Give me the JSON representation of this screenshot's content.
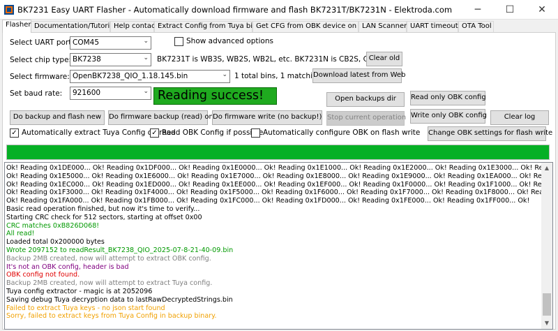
{
  "window": {
    "title": "BK7231 Easy UART Flasher - Automatically download firmware and flash BK7231T/BK7231N - Elektroda.com",
    "minimize_glyph": "─",
    "maximize_glyph": "☐",
    "close_glyph": "✕"
  },
  "tabs": [
    {
      "label": "Flasher"
    },
    {
      "label": "Documentation/Tutorials"
    },
    {
      "label": "Help contact"
    },
    {
      "label": "Extract Config from Tuya binary"
    },
    {
      "label": "Get CFG from OBK device on LAN"
    },
    {
      "label": "LAN Scanner"
    },
    {
      "label": "UART timeouts"
    },
    {
      "label": "OTA Tool"
    }
  ],
  "form": {
    "uart_port_label": "Select UART port:",
    "uart_port_value": "COM45",
    "show_advanced_label": "Show advanced options",
    "chip_type_label": "Select chip type:",
    "chip_type_value": "BK7238",
    "chip_info": "BK7231T is WB3S, WB2S, WB2L, etc. BK7231N is CB2S, CB3S, etc",
    "clear_old_label": "Clear old",
    "firmware_label": "Select firmware:",
    "firmware_value": "OpenBK7238_QIO_1.18.145.bin",
    "firmware_info": "1 total bins, 1 matching.",
    "download_latest_label": "Download latest from Web",
    "baud_label": "Set baud rate:",
    "baud_value": "921600",
    "status_text": "Reading success!"
  },
  "buttons": {
    "open_backups": "Open backups dir",
    "read_only_obk": "Read only OBK config",
    "backup_and_flash": "Do backup and flash new",
    "firmware_backup": "Do firmware backup (read) only",
    "firmware_write": "Do firmware write (no backup!)",
    "stop_operation": "Stop current operation",
    "write_only_obk": "Write only OBK config",
    "clear_log": "Clear log",
    "change_obk_settings": "Change OBK settings for flash write"
  },
  "checkboxes": {
    "extract_tuya": {
      "label": "Automatically extract Tuya Config on read",
      "checked": true
    },
    "read_obk": {
      "label": "Read OBK Config if possible",
      "checked": true
    },
    "auto_configure": {
      "label": "Automatically configure OBK on flash write",
      "checked": false
    }
  },
  "check_glyph": "✓",
  "dropdown_glyph": "⌄",
  "progress": {
    "fraction": 1.0
  },
  "colors": {
    "black": "#000000",
    "green": "#009900",
    "purple": "#800080",
    "red": "#e00000",
    "gray": "#808080",
    "orange": "#f0a000"
  },
  "log": [
    {
      "text": "Ok! Reading 0x1DE000... Ok! Reading 0x1DF000... Ok! Reading 0x1E0000... Ok! Reading 0x1E1000... Ok! Reading 0x1E2000... Ok! Reading 0x1E3000... Ok! Reading 0x1E4000...",
      "color": "black"
    },
    {
      "text": "Ok! Reading 0x1E5000... Ok! Reading 0x1E6000... Ok! Reading 0x1E7000... Ok! Reading 0x1E8000... Ok! Reading 0x1E9000... Ok! Reading 0x1EA000... Ok! Reading 0x1EB000...",
      "color": "black"
    },
    {
      "text": "Ok! Reading 0x1EC000... Ok! Reading 0x1ED000... Ok! Reading 0x1EE000... Ok! Reading 0x1EF000... Ok! Reading 0x1F0000... Ok! Reading 0x1F1000... Ok! Reading 0x1F2000...",
      "color": "black"
    },
    {
      "text": "Ok! Reading 0x1F3000... Ok! Reading 0x1F4000... Ok! Reading 0x1F5000... Ok! Reading 0x1F6000... Ok! Reading 0x1F7000... Ok! Reading 0x1F8000... Ok! Reading 0x1F9000...",
      "color": "black"
    },
    {
      "text": "Ok! Reading 0x1FA000... Ok! Reading 0x1FB000... Ok! Reading 0x1FC000... Ok! Reading 0x1FD000... Ok! Reading 0x1FE000... Ok! Reading 0x1FF000... Ok!",
      "color": "black"
    },
    {
      "text": "Basic read operation finished, but now it's time to verify...",
      "color": "black"
    },
    {
      "text": "Starting CRC check for 512 sectors, starting at offset 0x00",
      "color": "black"
    },
    {
      "text": "CRC matches 0xB826D068!",
      "color": "green"
    },
    {
      "text": "All read!",
      "color": "green"
    },
    {
      "text": "Loaded total 0x200000 bytes",
      "color": "black"
    },
    {
      "text": "Wrote 2097152 to readResult_BK7238_QIO_2025-07-8-21-40-09.bin",
      "color": "green"
    },
    {
      "text": "Backup 2MB created, now will attempt to extract OBK config.",
      "color": "gray"
    },
    {
      "text": "It's not an OBK config, header is bad",
      "color": "purple"
    },
    {
      "text": "OBK config not found.",
      "color": "red"
    },
    {
      "text": "Backup 2MB created, now will attempt to extract Tuya config.",
      "color": "gray"
    },
    {
      "text": "Tuya config extractor - magic is at 2052096",
      "color": "black"
    },
    {
      "text": "Saving debug Tuya decryption data to lastRawDecryptedStrings.bin",
      "color": "black"
    },
    {
      "text": "Failed to extract Tuya keys - no json start found",
      "color": "orange"
    },
    {
      "text": "Sorry, failed to extract keys from Tuya Config in backup binary.",
      "color": "orange"
    }
  ]
}
